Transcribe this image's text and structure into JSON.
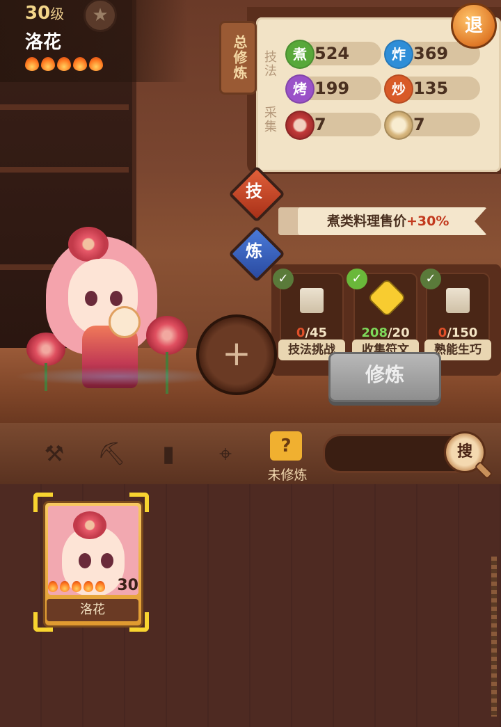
{
  "player": {
    "level": "30",
    "level_suffix": "级",
    "name": "洛花",
    "stars": 5
  },
  "exit_label": "退",
  "total_training_tab": "总修炼",
  "sections": {
    "technique_label": "技法",
    "gather_label": "采集"
  },
  "stats": {
    "boil": {
      "icon": "煮",
      "value": "524"
    },
    "fry": {
      "icon": "炸",
      "value": "369"
    },
    "roast": {
      "icon": "烤",
      "value": "199"
    },
    "stirfry": {
      "icon": "炒",
      "value": "135"
    },
    "meat": {
      "icon": "meat-icon",
      "value": "7"
    },
    "flour": {
      "icon": "flour-icon",
      "value": "7"
    }
  },
  "skill_button": "技",
  "refine_button": "炼",
  "bonus": {
    "text": "煮类料理售价",
    "amount": "+30%"
  },
  "tasks": [
    {
      "current": "0",
      "total": "/45",
      "label": "技法挑战",
      "done": true
    },
    {
      "current": "208",
      "total": "/20",
      "label": "收集符文",
      "done": true
    },
    {
      "current": "0",
      "total": "/150",
      "label": "熟能生巧",
      "done": true
    }
  ],
  "train_button": "修炼",
  "toolbar": {
    "untrained_label": "未修炼",
    "search_button": "搜",
    "search_value": ""
  },
  "character_card": {
    "name": "洛花",
    "level": "30"
  },
  "colors": {
    "accent_orange": "#e07a28",
    "bonus_red": "#c23a1e",
    "progress_red": "#e0502a",
    "progress_green": "#7ed85a"
  }
}
